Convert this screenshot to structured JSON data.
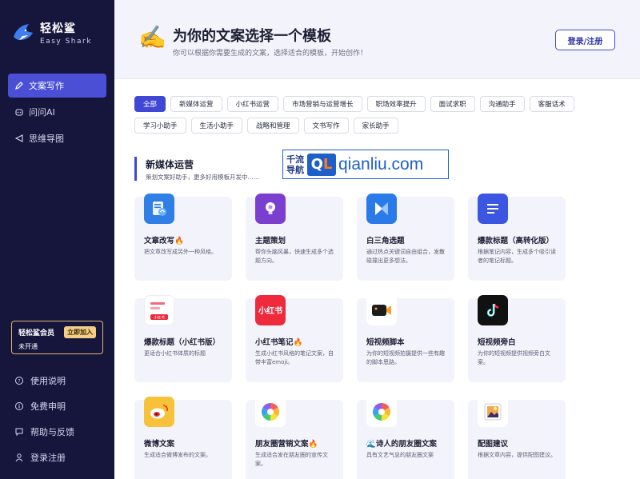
{
  "brand": {
    "name": "轻松鲨",
    "subtitle": "Easy Shark"
  },
  "nav": [
    {
      "label": "文案写作",
      "icon": "pen-icon",
      "active": true
    },
    {
      "label": "问问AI",
      "icon": "chat-bot-icon",
      "active": false
    },
    {
      "label": "思维导图",
      "icon": "mindmap-icon",
      "active": false
    }
  ],
  "member": {
    "title": "轻松鲨会员",
    "button": "立即加入",
    "status": "未开通"
  },
  "bottom_nav": [
    {
      "label": "使用说明",
      "icon": "help-circle-icon"
    },
    {
      "label": "免费申明",
      "icon": "info-circle-icon"
    },
    {
      "label": "帮助与反馈",
      "icon": "feedback-icon"
    },
    {
      "label": "登录注册",
      "icon": "user-icon"
    }
  ],
  "header": {
    "icon": "✍️",
    "title": "为你的文案选择一个模板",
    "subtitle": "你可以根据你需要生成的文案，选择适合的模板，开始创作！",
    "login_label": "登录/注册"
  },
  "filters": [
    "全部",
    "新媒体运营",
    "小红书运营",
    "市场营销与运营增长",
    "职场效率提升",
    "面试求职",
    "沟通助手",
    "客服话术",
    "学习小助手",
    "生活小助手",
    "战略和管理",
    "文书写作",
    "家长助手"
  ],
  "section": {
    "title": "新媒体运营",
    "subtitle": "策划文案好助手，更多好用模板开发中......"
  },
  "watermark": {
    "left_line1": "千流",
    "left_line2": "导航",
    "q": "Q",
    "l": "L",
    "right": "qianliu.com"
  },
  "cards": [
    {
      "title": "文章改写🔥",
      "desc": "把文章改写成另外一种风格。",
      "icon": "article-rewrite-icon",
      "color": "#2f7fe6"
    },
    {
      "title": "主题策划",
      "desc": "帮你头脑风暴，快速生成多个选题方向。",
      "icon": "lightbulb-icon",
      "color": "#7b3fd0"
    },
    {
      "title": "白三角选题",
      "desc": "通过热点关键词自由组合，发散碰撞出更多想法。",
      "icon": "triangle-icon",
      "color": "#2a7be8"
    },
    {
      "title": "爆款标题（高转化版）",
      "desc": "根据笔记内容，生成多个吸引读者的笔记标题。",
      "icon": "headline-icon",
      "color": "#3b56e0"
    },
    {
      "title": "爆款标题（小红书版）",
      "desc": "更适合小红书体质的标题",
      "icon": "xiaohongshu-title-icon",
      "color": "#ffffff"
    },
    {
      "title": "小红书笔记🔥",
      "desc": "生成小红书风格的笔记文案，自带丰富emoji。",
      "icon": "xiaohongshu-icon",
      "color": "#ee2a3c"
    },
    {
      "title": "短视频脚本",
      "desc": "为你的短视频拍摄提供一些有趣的脚本思路。",
      "icon": "video-camera-icon",
      "color": "#ffffff"
    },
    {
      "title": "短视频旁白",
      "desc": "为你的短视频提供视频旁白文案。",
      "icon": "tiktok-icon",
      "color": "#111111"
    },
    {
      "title": "微博文案",
      "desc": "生成适合微博发布的文案。",
      "icon": "weibo-icon",
      "color": "#f7c23a"
    },
    {
      "title": "朋友圈营销文案🔥",
      "desc": "生成适合发在朋友圈的宣传文案。",
      "icon": "moments-icon",
      "color": "#ffffff"
    },
    {
      "title": "🌊诗人的朋友圈文案",
      "desc": "具有文艺气息的朋友圈文案",
      "icon": "moments-poet-icon",
      "color": "#ffffff"
    },
    {
      "title": "配图建议",
      "desc": "根据文章内容，提供配图建议。",
      "icon": "picture-icon",
      "color": "#ffffff"
    }
  ]
}
